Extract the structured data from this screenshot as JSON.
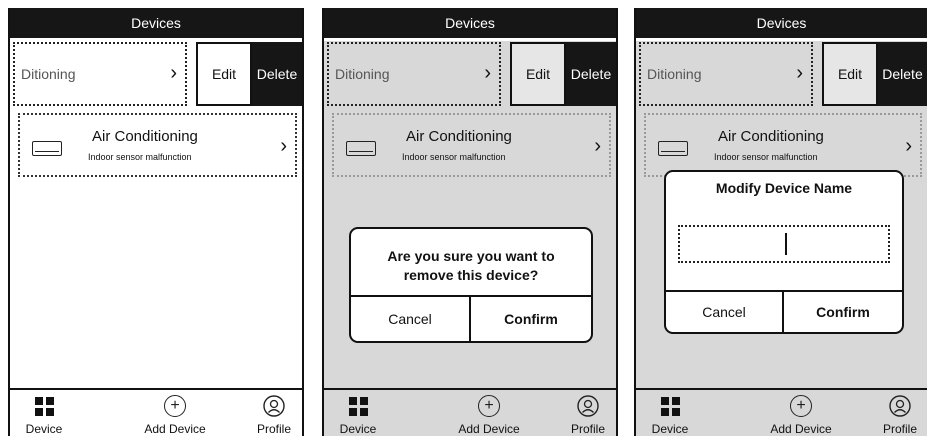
{
  "header": {
    "title": "Devices"
  },
  "swipe_row": {
    "item_label": "Ditioning",
    "edit_label": "Edit",
    "delete_label": "Delete"
  },
  "device": {
    "name": "Air Conditioning",
    "status": "Indoor sensor malfunction"
  },
  "tabs": [
    {
      "label": "Device",
      "icon": "grid-icon"
    },
    {
      "label": "Add Device",
      "icon": "add-circle-icon"
    },
    {
      "label": "Profile",
      "icon": "profile-icon"
    }
  ],
  "delete_dialog": {
    "message_line1": "Are you sure you want to",
    "message_line2": "remove this device?",
    "cancel_label": "Cancel",
    "confirm_label": "Confirm"
  },
  "rename_dialog": {
    "title": "Modify Device Name",
    "input_value": "",
    "cancel_label": "Cancel",
    "confirm_label": "Confirm"
  },
  "colors": {
    "titlebar": "#161616",
    "overlay": "#d8d8d8",
    "delete": "#161616"
  }
}
